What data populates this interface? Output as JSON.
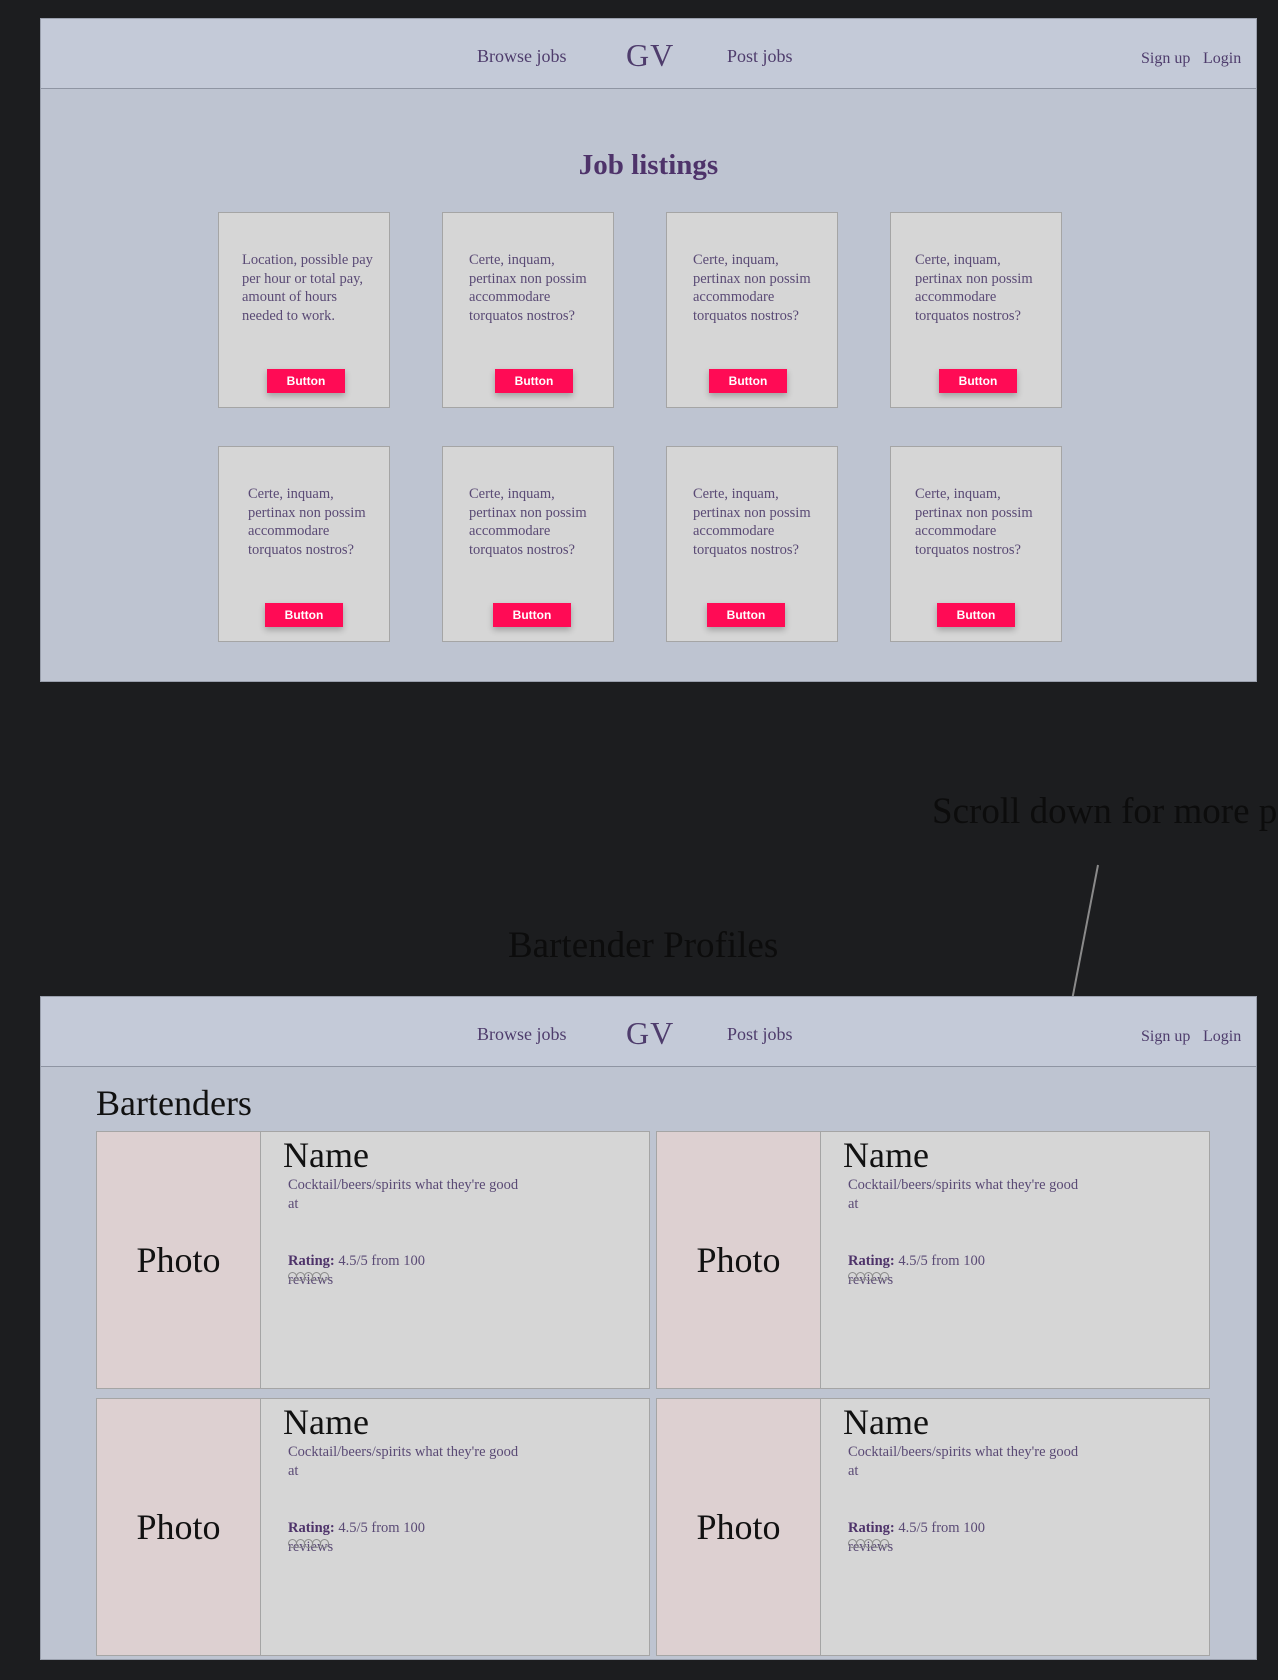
{
  "nav": {
    "browse_jobs": "Browse jobs",
    "logo": "GV",
    "post_jobs": "Post jobs",
    "sign_up": "Sign up",
    "login": "Login"
  },
  "jobs_section": {
    "title": "Job listings",
    "cards": [
      {
        "text": "Location, possible pay per hour or total pay, amount of hours needed to work.",
        "button": "Button"
      },
      {
        "text": "Certe, inquam, pertinax non possim accommodare torquatos nostros?",
        "button": "Button"
      },
      {
        "text": "Certe, inquam, pertinax non possim accommodare torquatos nostros?",
        "button": "Button"
      },
      {
        "text": "Certe, inquam, pertinax non possim accommodare torquatos nostros?",
        "button": "Button"
      },
      {
        "text": "Certe, inquam, pertinax non possim accommodare torquatos nostros?",
        "button": "Button"
      },
      {
        "text": "Certe, inquam, pertinax non possim accommodare torquatos nostros?",
        "button": "Button"
      },
      {
        "text": "Certe, inquam, pertinax non possim accommodare torquatos nostros?",
        "button": "Button"
      },
      {
        "text": "Certe, inquam, pertinax non possim accommodare torquatos nostros?",
        "button": "Button"
      }
    ]
  },
  "annotations": {
    "scroll_note": "Scroll down for more p",
    "bartender_profiles": "Bartender Profiles"
  },
  "bartenders_section": {
    "heading": "Bartenders",
    "profiles": [
      {
        "photo": "Photo",
        "name": "Name",
        "skills": "Cocktail/beers/spirits what they're good at",
        "rating_label": "Rating:",
        "rating_value": "4.5/5 from 100 reviews",
        "stars": 5
      },
      {
        "photo": "Photo",
        "name": "Name",
        "skills": "Cocktail/beers/spirits what they're good at",
        "rating_label": "Rating:",
        "rating_value": "4.5/5 from 100 reviews",
        "stars": 5
      },
      {
        "photo": "Photo",
        "name": "Name",
        "skills": "Cocktail/beers/spirits what they're good at",
        "rating_label": "Rating:",
        "rating_value": "4.5/5 from 100 reviews",
        "stars": 5
      },
      {
        "photo": "Photo",
        "name": "Name",
        "skills": "Cocktail/beers/spirits what they're good at",
        "rating_label": "Rating:",
        "rating_value": "4.5/5 from 100 reviews",
        "stars": 5
      }
    ]
  },
  "colors": {
    "background": "#1c1d1f",
    "frame": "#bec4d1",
    "navbar": "#c4cad8",
    "card": "#d6d6d6",
    "photo": "#ddd0d1",
    "accent_button": "#ff0b55",
    "text_purple": "#4e336a"
  }
}
